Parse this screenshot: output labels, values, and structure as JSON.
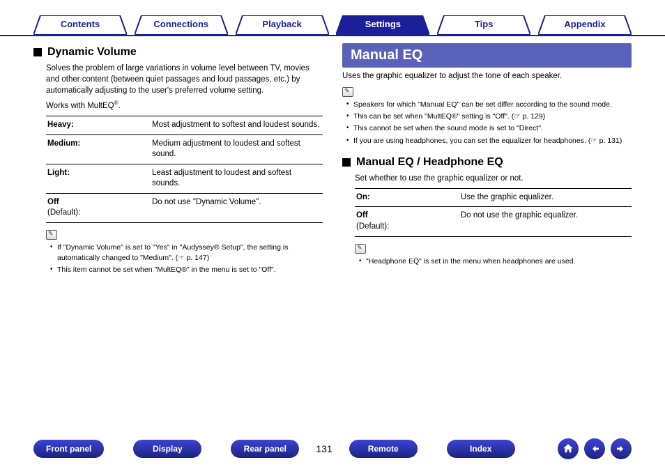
{
  "topnav": {
    "tabs": [
      {
        "label": "Contents",
        "active": false
      },
      {
        "label": "Connections",
        "active": false
      },
      {
        "label": "Playback",
        "active": false
      },
      {
        "label": "Settings",
        "active": true
      },
      {
        "label": "Tips",
        "active": false
      },
      {
        "label": "Appendix",
        "active": false
      }
    ]
  },
  "left": {
    "heading": "Dynamic Volume",
    "desc": "Solves the problem of large variations in volume level between TV, movies and other content (between quiet passages and loud passages, etc.) by automatically adjusting to the user's preferred volume setting.",
    "works_prefix": "Works with MultEQ",
    "works_suffix": ".",
    "options": [
      {
        "label": "Heavy:",
        "desc": "Most adjustment to softest and loudest sounds."
      },
      {
        "label": "Medium:",
        "desc": "Medium adjustment to loudest and softest sound."
      },
      {
        "label": "Light:",
        "desc": "Least adjustment to loudest and softest sounds."
      },
      {
        "label": "Off",
        "sub": "(Default):",
        "desc": "Do not use \"Dynamic Volume\"."
      }
    ],
    "notes": [
      "If \"Dynamic Volume\" is set to \"Yes\" in \"Audyssey® Setup\", the setting is automatically changed to \"Medium\".  (☞ p. 147)",
      "This item cannot be set when \"MultEQ®\" in the menu is set to \"Off\"."
    ]
  },
  "right": {
    "banner": "Manual EQ",
    "desc": "Uses the graphic equalizer to adjust the tone of each speaker.",
    "notes1": [
      "Speakers for which \"Manual EQ\" can be set differ according to the sound mode.",
      "This can be set when \"MultEQ®\" setting is \"Off\".  (☞ p. 129)",
      "This cannot be set when the sound mode is set to \"Direct\".",
      "If you are using headphones, you can set the equalizer for headphones. (☞ p. 131)"
    ],
    "sub_heading": "Manual EQ / Headphone EQ",
    "sub_desc": "Set whether to use the graphic equalizer or not.",
    "options": [
      {
        "label": "On:",
        "desc": "Use the graphic equalizer."
      },
      {
        "label": "Off",
        "sub": "(Default):",
        "desc": "Do not use the graphic equalizer."
      }
    ],
    "notes2": [
      "\"Headphone EQ\" is set in the menu when headphones are used."
    ]
  },
  "footer": {
    "buttons": [
      "Front panel",
      "Display",
      "Rear panel"
    ],
    "page": "131",
    "buttons2": [
      "Remote",
      "Index"
    ]
  }
}
